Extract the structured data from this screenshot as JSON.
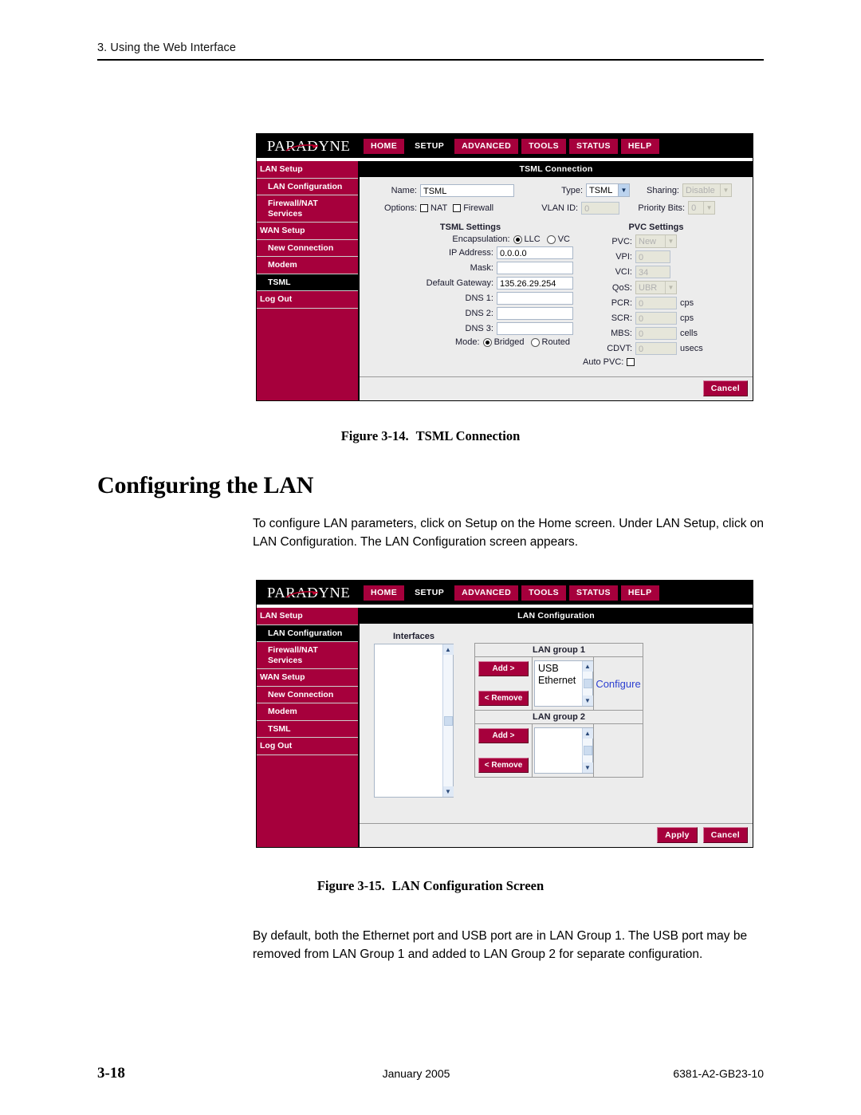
{
  "page": {
    "header": "3. Using the Web Interface",
    "footer_page": "3-18",
    "footer_date": "January 2005",
    "footer_docid": "6381-A2-GB23-10"
  },
  "section": {
    "heading": "Configuring the LAN",
    "paragraph_1": "To configure LAN parameters, click on Setup on the Home screen. Under LAN Setup, click on LAN Configuration. The LAN Configuration screen appears.",
    "paragraph_2": "By default, both the Ethernet port and USB port are in LAN Group 1. The USB port may be removed from LAN Group 1 and added to LAN Group 2 for separate configuration."
  },
  "figures": {
    "fig314": {
      "number": "Figure 3-14.",
      "title": "TSML Connection"
    },
    "fig315": {
      "number": "Figure 3-15.",
      "title": "LAN Configuration Screen"
    }
  },
  "colors": {
    "brand_maroon": "#a6003c",
    "active_black": "#000000",
    "link_blue": "#2b3fd0",
    "panel_gray": "#ececec"
  },
  "ui_common": {
    "logo": "PARADYNE",
    "navtabs": [
      {
        "label": "HOME",
        "active": false
      },
      {
        "label": "SETUP",
        "active": true
      },
      {
        "label": "ADVANCED",
        "active": false
      },
      {
        "label": "TOOLS",
        "active": false
      },
      {
        "label": "STATUS",
        "active": false
      },
      {
        "label": "HELP",
        "active": false
      }
    ],
    "sidebar": [
      {
        "label": "LAN Setup",
        "sub": false
      },
      {
        "label": "LAN Configuration",
        "sub": true
      },
      {
        "label": "Firewall/NAT Services",
        "sub": true
      },
      {
        "label": "WAN Setup",
        "sub": false
      },
      {
        "label": "New Connection",
        "sub": true
      },
      {
        "label": "Modem",
        "sub": true
      },
      {
        "label": "TSML",
        "sub": true
      },
      {
        "label": "Log Out",
        "sub": false
      }
    ]
  },
  "screen_tsml": {
    "title": "TSML Connection",
    "active_sidebar": "TSML",
    "name_label": "Name:",
    "name_value": "TSML",
    "type_label": "Type:",
    "type_value": "TSML",
    "sharing_label": "Sharing:",
    "sharing_value": "Disable",
    "options_label": "Options:",
    "nat_label": "NAT",
    "firewall_label": "Firewall",
    "vlan_label": "VLAN ID:",
    "vlan_value": "0",
    "priority_label": "Priority Bits:",
    "priority_value": "0",
    "tsml_settings_title": "TSML Settings",
    "encapsulation_label": "Encapsulation:",
    "encap_llc": "LLC",
    "encap_vc": "VC",
    "ip_label": "IP Address:",
    "ip_value": "0.0.0.0",
    "mask_label": "Mask:",
    "mask_value": "",
    "gateway_label": "Default Gateway:",
    "gateway_value": "135.26.29.254",
    "dns1_label": "DNS 1:",
    "dns1_value": "",
    "dns2_label": "DNS 2:",
    "dns2_value": "",
    "dns3_label": "DNS 3:",
    "dns3_value": "",
    "mode_label": "Mode:",
    "mode_bridged": "Bridged",
    "mode_routed": "Routed",
    "pvc_settings_title": "PVC Settings",
    "pvc_label": "PVC:",
    "pvc_value": "New",
    "vpi_label": "VPI:",
    "vpi_value": "0",
    "vci_label": "VCI:",
    "vci_value": "34",
    "qos_label": "QoS:",
    "qos_value": "UBR",
    "pcr_label": "PCR:",
    "pcr_value": "0",
    "pcr_unit": "cps",
    "scr_label": "SCR:",
    "scr_value": "0",
    "scr_unit": "cps",
    "mbs_label": "MBS:",
    "mbs_value": "0",
    "mbs_unit": "cells",
    "cdvt_label": "CDVT:",
    "cdvt_value": "0",
    "cdvt_unit": "usecs",
    "autopvc_label": "Auto PVC:",
    "cancel_label": "Cancel"
  },
  "screen_lan": {
    "title": "LAN Configuration",
    "active_sidebar": "LAN Configuration",
    "interfaces_label": "Interfaces",
    "interfaces_items": [],
    "group1_title": "LAN group 1",
    "group1_items": [
      "USB",
      "Ethernet"
    ],
    "group2_title": "LAN group 2",
    "group2_items": [],
    "add_label": "Add >",
    "remove_label": "< Remove",
    "configure_label": "Configure",
    "apply_label": "Apply",
    "cancel_label": "Cancel"
  }
}
